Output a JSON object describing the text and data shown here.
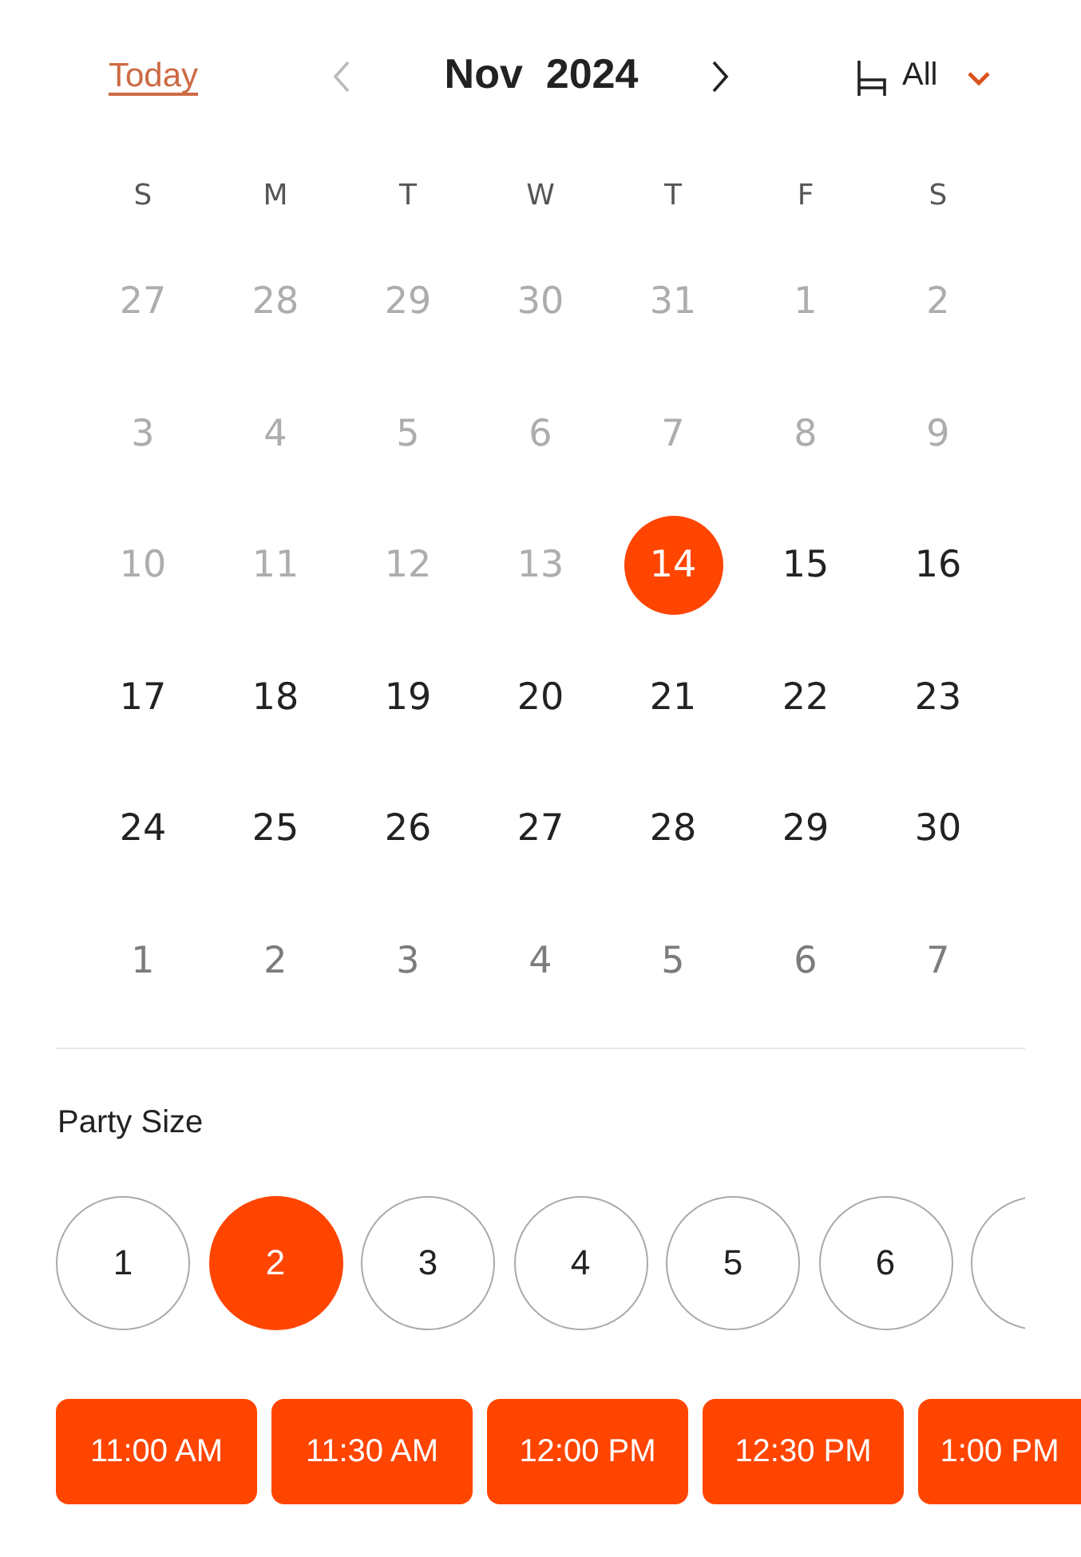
{
  "header": {
    "today_link": "Today",
    "month_title": "Nov  2024",
    "prev_disabled": true,
    "filter_label": "All"
  },
  "weekdays": [
    "S",
    "M",
    "T",
    "W",
    "T",
    "F",
    "S"
  ],
  "days": [
    {
      "label": "27",
      "kind": "past",
      "selected": false
    },
    {
      "label": "28",
      "kind": "past",
      "selected": false
    },
    {
      "label": "29",
      "kind": "past",
      "selected": false
    },
    {
      "label": "30",
      "kind": "past",
      "selected": false
    },
    {
      "label": "31",
      "kind": "past",
      "selected": false
    },
    {
      "label": "1",
      "kind": "past",
      "selected": false
    },
    {
      "label": "2",
      "kind": "past",
      "selected": false
    },
    {
      "label": "3",
      "kind": "past",
      "selected": false
    },
    {
      "label": "4",
      "kind": "past",
      "selected": false
    },
    {
      "label": "5",
      "kind": "past",
      "selected": false
    },
    {
      "label": "6",
      "kind": "past",
      "selected": false
    },
    {
      "label": "7",
      "kind": "past",
      "selected": false
    },
    {
      "label": "8",
      "kind": "past",
      "selected": false
    },
    {
      "label": "9",
      "kind": "past",
      "selected": false
    },
    {
      "label": "10",
      "kind": "past",
      "selected": false
    },
    {
      "label": "11",
      "kind": "past",
      "selected": false
    },
    {
      "label": "12",
      "kind": "past",
      "selected": false
    },
    {
      "label": "13",
      "kind": "past",
      "selected": false
    },
    {
      "label": "14",
      "kind": "available",
      "selected": true
    },
    {
      "label": "15",
      "kind": "available",
      "selected": false
    },
    {
      "label": "16",
      "kind": "available",
      "selected": false
    },
    {
      "label": "17",
      "kind": "available",
      "selected": false
    },
    {
      "label": "18",
      "kind": "available",
      "selected": false
    },
    {
      "label": "19",
      "kind": "available",
      "selected": false
    },
    {
      "label": "20",
      "kind": "available",
      "selected": false
    },
    {
      "label": "21",
      "kind": "available",
      "selected": false
    },
    {
      "label": "22",
      "kind": "available",
      "selected": false
    },
    {
      "label": "23",
      "kind": "available",
      "selected": false
    },
    {
      "label": "24",
      "kind": "available",
      "selected": false
    },
    {
      "label": "25",
      "kind": "available",
      "selected": false
    },
    {
      "label": "26",
      "kind": "available",
      "selected": false
    },
    {
      "label": "27",
      "kind": "available",
      "selected": false
    },
    {
      "label": "28",
      "kind": "available",
      "selected": false
    },
    {
      "label": "29",
      "kind": "available",
      "selected": false
    },
    {
      "label": "30",
      "kind": "available",
      "selected": false
    },
    {
      "label": "1",
      "kind": "next",
      "selected": false
    },
    {
      "label": "2",
      "kind": "next",
      "selected": false
    },
    {
      "label": "3",
      "kind": "next",
      "selected": false
    },
    {
      "label": "4",
      "kind": "next",
      "selected": false
    },
    {
      "label": "5",
      "kind": "next",
      "selected": false
    },
    {
      "label": "6",
      "kind": "next",
      "selected": false
    },
    {
      "label": "7",
      "kind": "next",
      "selected": false
    }
  ],
  "party_size": {
    "label": "Party Size",
    "options": [
      {
        "label": "1",
        "selected": false
      },
      {
        "label": "2",
        "selected": true
      },
      {
        "label": "3",
        "selected": false
      },
      {
        "label": "4",
        "selected": false
      },
      {
        "label": "5",
        "selected": false
      },
      {
        "label": "6",
        "selected": false
      }
    ]
  },
  "time_slots": [
    "11:00 AM",
    "11:30 AM",
    "12:00 PM",
    "12:30 PM",
    "1:00 PM"
  ]
}
